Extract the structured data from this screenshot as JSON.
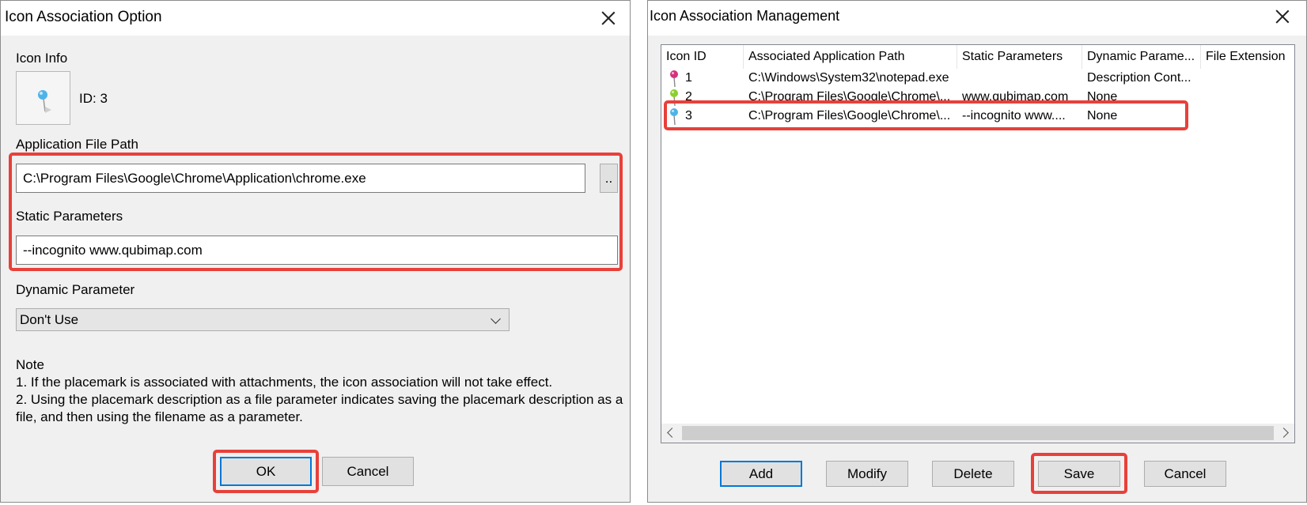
{
  "option_dialog": {
    "title": "Icon Association Option",
    "icon_info_label": "Icon Info",
    "icon_id_text": "ID: 3",
    "app_path_label": "Application File Path",
    "app_path_value": "C:\\Program Files\\Google\\Chrome\\Application\\chrome.exe",
    "browse_label": "..",
    "static_params_label": "Static Parameters",
    "static_params_value": "--incognito www.qubimap.com",
    "dynamic_param_label": "Dynamic Parameter",
    "dynamic_param_value": "Don't Use",
    "note_title": "Note",
    "note_line1": "1. If the placemark is associated with attachments, the icon association will not take effect.",
    "note_line2": "2. Using the placemark description as a file parameter indicates saving the placemark description as a file, and then using the filename as a parameter.",
    "ok_label": "OK",
    "cancel_label": "Cancel"
  },
  "management_dialog": {
    "title": "Icon Association Management",
    "columns": [
      "Icon ID",
      "Associated Application Path",
      "Static Parameters",
      "Dynamic Parame...",
      "File Extension"
    ],
    "rows": [
      {
        "id": "1",
        "pin_color": "#d6327c",
        "path": "C:\\Windows\\System32\\notepad.exe",
        "static": "",
        "dynamic": "Description Cont...",
        "ext": ""
      },
      {
        "id": "2",
        "pin_color": "#8ccf2e",
        "path": "C:\\Program Files\\Google\\Chrome\\...",
        "static": "www.qubimap.com",
        "dynamic": "None",
        "ext": ""
      },
      {
        "id": "3",
        "pin_color": "#4fb3e8",
        "path": "C:\\Program Files\\Google\\Chrome\\...",
        "static": "--incognito www....",
        "dynamic": "None",
        "ext": ""
      }
    ],
    "buttons": {
      "add": "Add",
      "modify": "Modify",
      "delete": "Delete",
      "save": "Save",
      "cancel": "Cancel"
    }
  },
  "colors": {
    "highlight": "#e8403a",
    "focus_border": "#0078d7"
  }
}
